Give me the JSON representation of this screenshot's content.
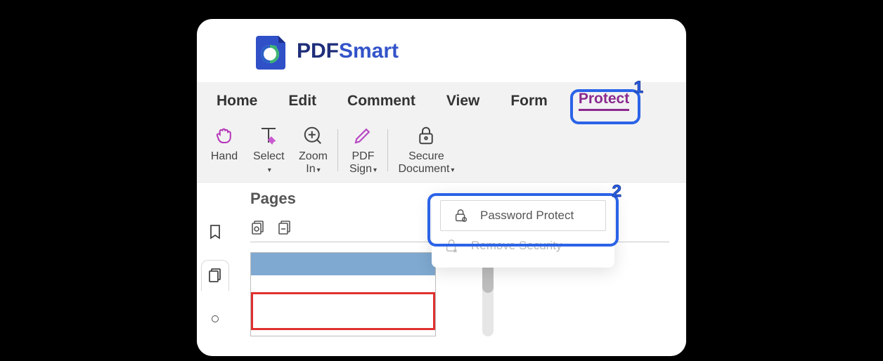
{
  "brand": {
    "pdf": "PDF",
    "smart": "Smart"
  },
  "tabs": {
    "home": "Home",
    "edit": "Edit",
    "comment": "Comment",
    "view": "View",
    "form": "Form",
    "protect": "Protect"
  },
  "toolbar": {
    "hand": "Hand",
    "select": "Select",
    "zoom_in": "Zoom\nIn",
    "pdf_sign": "PDF\nSign",
    "secure_doc": "Secure\nDocument"
  },
  "pages": {
    "title": "Pages"
  },
  "menu": {
    "password_protect": "Password Protect",
    "remove_security": "Remove Security"
  },
  "callouts": {
    "one": "1",
    "two": "2"
  }
}
